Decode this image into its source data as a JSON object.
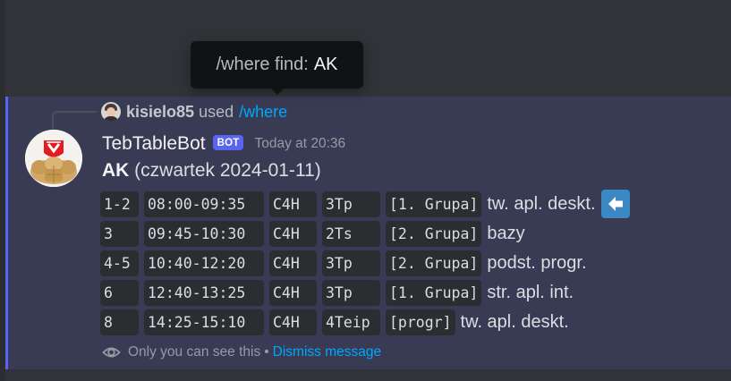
{
  "tooltip": {
    "label": "/where find:",
    "value": "AK"
  },
  "interaction": {
    "username": "kisielo85",
    "used_text": "used",
    "command": "/where"
  },
  "message": {
    "author": "TebTableBot",
    "bot_tag": "BOT",
    "timestamp": "Today at 20:36",
    "title_bold": "AK",
    "title_rest": " (czwartek 2024-01-11)"
  },
  "schedule": [
    {
      "lesson": "1-2",
      "time": "08:00-09:35",
      "room": "C4H",
      "class": "3Tp",
      "group": "[1. Grupa]",
      "subject": "tw. apl. deskt."
    },
    {
      "lesson": "3",
      "time": "09:45-10:30",
      "room": "C4H",
      "class": "2Ts",
      "group": "[2. Grupa]",
      "subject": "bazy"
    },
    {
      "lesson": "4-5",
      "time": "10:40-12:20",
      "room": "C4H",
      "class": "3Tp",
      "group": "[2. Grupa]",
      "subject": "podst. progr."
    },
    {
      "lesson": "6",
      "time": "12:40-13:25",
      "room": "C4H",
      "class": "3Tp",
      "group": "[1. Grupa]",
      "subject": "str. apl. int."
    },
    {
      "lesson": "8",
      "time": "14:25-15:10",
      "room": "C4H",
      "class": "4Teip",
      "group": "[progr]",
      "subject": "tw. apl. deskt."
    }
  ],
  "current_lesson_marker": "arrow-left-icon",
  "footer": {
    "ephemeral_text": "Only you can see this",
    "separator": "•",
    "dismiss_label": "Dismiss message"
  },
  "colors": {
    "background": "#313338",
    "highlight": "#393b54",
    "accent": "#5865f2",
    "link": "#00a8fc",
    "tooltip_bg": "#111214"
  }
}
